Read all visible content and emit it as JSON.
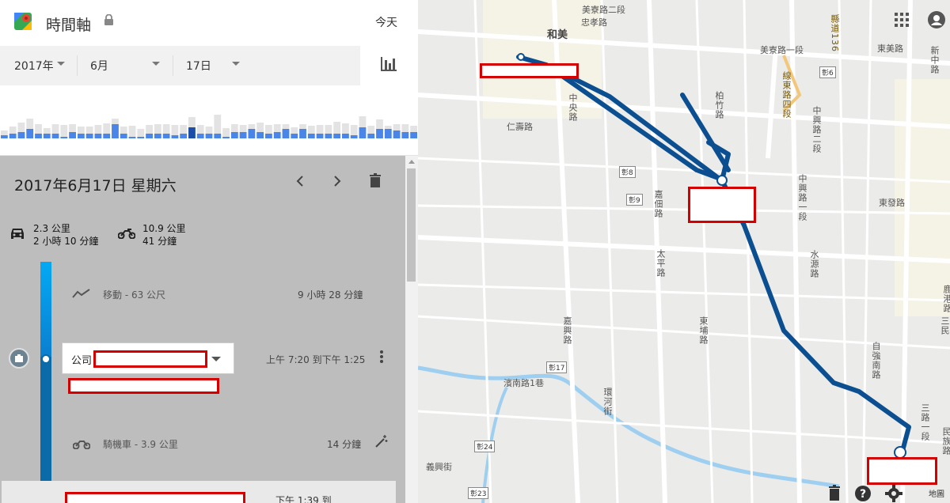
{
  "header": {
    "title": "時間軸",
    "today_label": "今天"
  },
  "filters": {
    "year": "2017年",
    "month": "6月",
    "day": "17日"
  },
  "histogram": {
    "bars": [
      {
        "grey": 10,
        "blue": 4
      },
      {
        "grey": 15,
        "blue": 6
      },
      {
        "grey": 20,
        "blue": 8
      },
      {
        "grey": 25,
        "blue": 12
      },
      {
        "grey": 18,
        "blue": 6
      },
      {
        "grey": 13,
        "blue": 6
      },
      {
        "grey": 18,
        "blue": 6
      },
      {
        "grey": 17,
        "blue": 2
      },
      {
        "grey": 18,
        "blue": 8
      },
      {
        "grey": 15,
        "blue": 6
      },
      {
        "grey": 15,
        "blue": 6
      },
      {
        "grey": 17,
        "blue": 6
      },
      {
        "grey": 19,
        "blue": 6
      },
      {
        "grey": 25,
        "blue": 18
      },
      {
        "grey": 15,
        "blue": 6
      },
      {
        "grey": 16,
        "blue": 2
      },
      {
        "grey": 12,
        "blue": 2
      },
      {
        "grey": 17,
        "blue": 6
      },
      {
        "grey": 18,
        "blue": 6
      },
      {
        "grey": 18,
        "blue": 6
      },
      {
        "grey": 17,
        "blue": 4
      },
      {
        "grey": 17,
        "blue": 6
      },
      {
        "grey": 27,
        "blue": 14
      },
      {
        "grey": 17,
        "blue": 6
      },
      {
        "grey": 15,
        "blue": 6
      },
      {
        "grey": 30,
        "blue": 6
      },
      {
        "grey": 13,
        "blue": 2
      },
      {
        "grey": 18,
        "blue": 8
      },
      {
        "grey": 17,
        "blue": 8
      },
      {
        "grey": 18,
        "blue": 12
      },
      {
        "grey": 20,
        "blue": 8
      },
      {
        "grey": 17,
        "blue": 6
      },
      {
        "grey": 18,
        "blue": 8
      },
      {
        "grey": 18,
        "blue": 12
      },
      {
        "grey": 14,
        "blue": 6
      },
      {
        "grey": 18,
        "blue": 12
      },
      {
        "grey": 16,
        "blue": 6
      },
      {
        "grey": 17,
        "blue": 6
      },
      {
        "grey": 17,
        "blue": 6
      },
      {
        "grey": 21,
        "blue": 6
      },
      {
        "grey": 19,
        "blue": 6
      },
      {
        "grey": 17,
        "blue": 4
      },
      {
        "grey": 28,
        "blue": 14
      },
      {
        "grey": 16,
        "blue": 6
      },
      {
        "grey": 24,
        "blue": 12
      },
      {
        "grey": 16,
        "blue": 12
      },
      {
        "grey": 18,
        "blue": 10
      },
      {
        "grey": 18,
        "blue": 8
      },
      {
        "grey": 16,
        "blue": 8
      }
    ],
    "bar_grey": "#e3e3e3",
    "bar_blue": "#4a86e8",
    "bar_selected": "#1b4ea8"
  },
  "day": {
    "title": "2017年6月17日 星期六",
    "car": {
      "distance": "2.3 公里",
      "duration": "2 小時 10 分鐘"
    },
    "moto": {
      "distance": "10.9 公里",
      "duration": "41 分鐘"
    }
  },
  "timeline": {
    "move": {
      "label": "移動 - 63 公尺",
      "duration": "9 小時 28 分鐘"
    },
    "place": {
      "name": "公司",
      "time": "上午 7:20 到下午 1:25"
    },
    "ride": {
      "label": "騎機車 - 3.9 公里",
      "duration": "14 分鐘"
    },
    "next": {
      "time": "下午 1:39 到"
    }
  },
  "map": {
    "route_color": "#0b4f91",
    "labels": {
      "hemei": "和美",
      "meiliao_road2": "美寮路二段",
      "zhongxiao": "忠孝路",
      "meiliao_road1": "美寮路一段",
      "county136": "縣道136",
      "xiangang4": "線東路四段",
      "dongmei": "東美路",
      "xinzhong": "新中路",
      "changchang6": "彰6",
      "zhongyang": "中央路",
      "renshou": "仁壽路",
      "changchang8": "彰8",
      "changchang9": "彰9",
      "jiatian": "嘉佃路",
      "baizhu": "柏竹路",
      "zhongxing2": "中興路二段",
      "zhongxing1": "中興路一段",
      "donghua": "東發路",
      "taiping": "太平路",
      "jiaxing": "嘉興路",
      "dongpu": "東埔路",
      "shuiyuan": "水源路",
      "huancheng": "環河街",
      "binnan": "濱南路1巷",
      "changchang17": "彰17",
      "changchang24": "彰24",
      "yixing": "義興街",
      "changchang23": "彰23",
      "zigiang": "自強南路",
      "changchang_road1": "三路一段",
      "mintsu": "民族路",
      "map_type": "地圖",
      "sanmin": "三民",
      "guanglu": "鹿港路"
    }
  }
}
